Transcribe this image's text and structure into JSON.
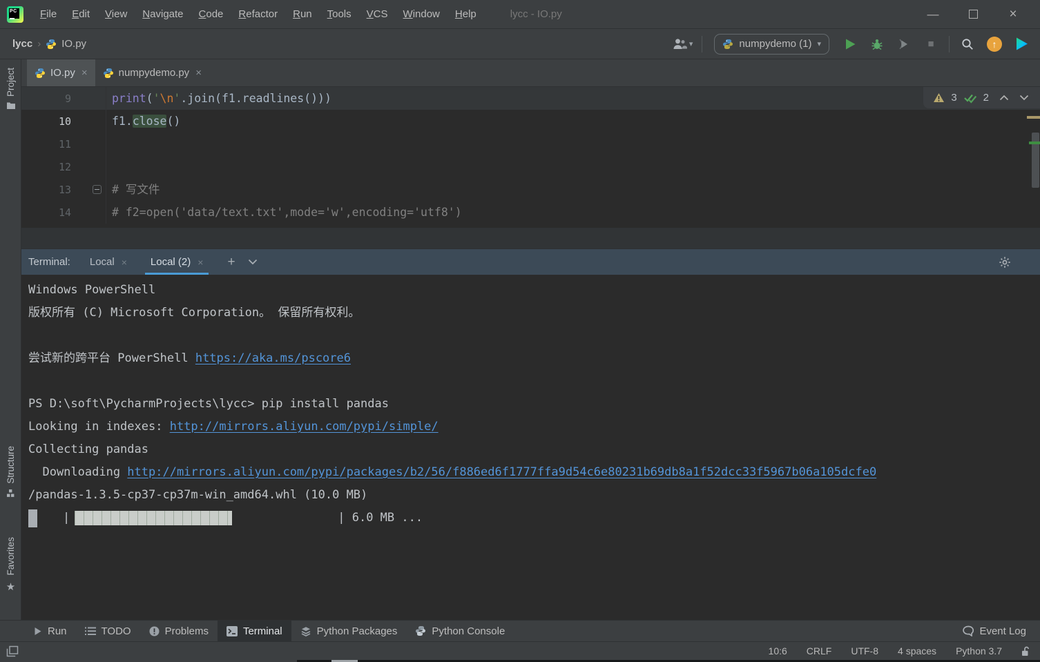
{
  "colors": {
    "accent_blue": "#4A9BD5",
    "link_blue": "#5394D8",
    "run_green": "#59A869",
    "warning_tan": "#B9A96E",
    "update_orange": "#E8A33D",
    "editor_bg": "#2B2B2B",
    "panel_bg": "#3C3F41",
    "terminal_header_bg": "#3C4A57"
  },
  "titlebar": {
    "title": "lycc - IO.py",
    "menu": [
      "File",
      "Edit",
      "View",
      "Navigate",
      "Code",
      "Refactor",
      "Run",
      "Tools",
      "VCS",
      "Window",
      "Help"
    ]
  },
  "navbar": {
    "breadcrumb_root": "lycc",
    "breadcrumb_file": "IO.py",
    "run_config": "numpydemo (1)"
  },
  "sidebar": {
    "project": "Project",
    "structure": "Structure",
    "favorites": "Favorites"
  },
  "editor": {
    "tabs": [
      {
        "label": "IO.py"
      },
      {
        "label": "numpydemo.py"
      }
    ],
    "inspections": {
      "warnings": "3",
      "passed": "2"
    },
    "code": {
      "l9": {
        "num": "9",
        "kw": "print",
        "open": "(",
        "q1": "'",
        "esc": "\\n",
        "q2": "'",
        "rest": ".join(f1.readlines()))"
      },
      "l10": {
        "num": "10",
        "pre": "f1.",
        "hl": "close",
        "post": "()"
      },
      "l11": {
        "num": "11"
      },
      "l12": {
        "num": "12"
      },
      "l13": {
        "num": "13",
        "comment": "# 写文件"
      },
      "l14": {
        "num": "14",
        "comment": "# f2=open('data/text.txt',mode='w',encoding='utf8')"
      }
    }
  },
  "terminal": {
    "panel_label": "Terminal:",
    "tabs": [
      {
        "label": "Local"
      },
      {
        "label": "Local (2)"
      }
    ],
    "lines": {
      "l1": "Windows PowerShell",
      "l2": "版权所有 (C) Microsoft Corporation。 保留所有权利。",
      "l3_text": "尝试新的跨平台 PowerShell ",
      "l3_link": "https://aka.ms/pscore6",
      "l4": "PS D:\\soft\\PycharmProjects\\lycc> pip install pandas",
      "l5_text": "Looking in indexes: ",
      "l5_link": "http://mirrors.aliyun.com/pypi/simple/",
      "l6": "Collecting pandas",
      "l7_text": "  Downloading ",
      "l7_link": "http://mirrors.aliyun.com/pypi/packages/b2/56/f886ed6f1777ffa9d54c6e80231b69db8a1f52dcc33f5967b06a105dcfe0",
      "l8": "/pandas-1.3.5-cp37-cp37m-win_amd64.whl (10.0 MB)",
      "bar_open": "|",
      "bar_label": "| 6.0 MB ..."
    }
  },
  "toolbar_bottom": {
    "run": "Run",
    "todo": "TODO",
    "problems": "Problems",
    "terminal": "Terminal",
    "python_packages": "Python Packages",
    "python_console": "Python Console",
    "event_log": "Event Log"
  },
  "statusbar": {
    "caret": "10:6",
    "line_ending": "CRLF",
    "encoding": "UTF-8",
    "indent": "4 spaces",
    "interpreter": "Python 3.7"
  },
  "icons": {
    "close": "×",
    "plus": "+",
    "dropdown": "▾",
    "breadcrumb_sep": "›",
    "minimize": "—",
    "play": "▶",
    "stop": "■",
    "star": "★",
    "up_arrow": "↑"
  }
}
